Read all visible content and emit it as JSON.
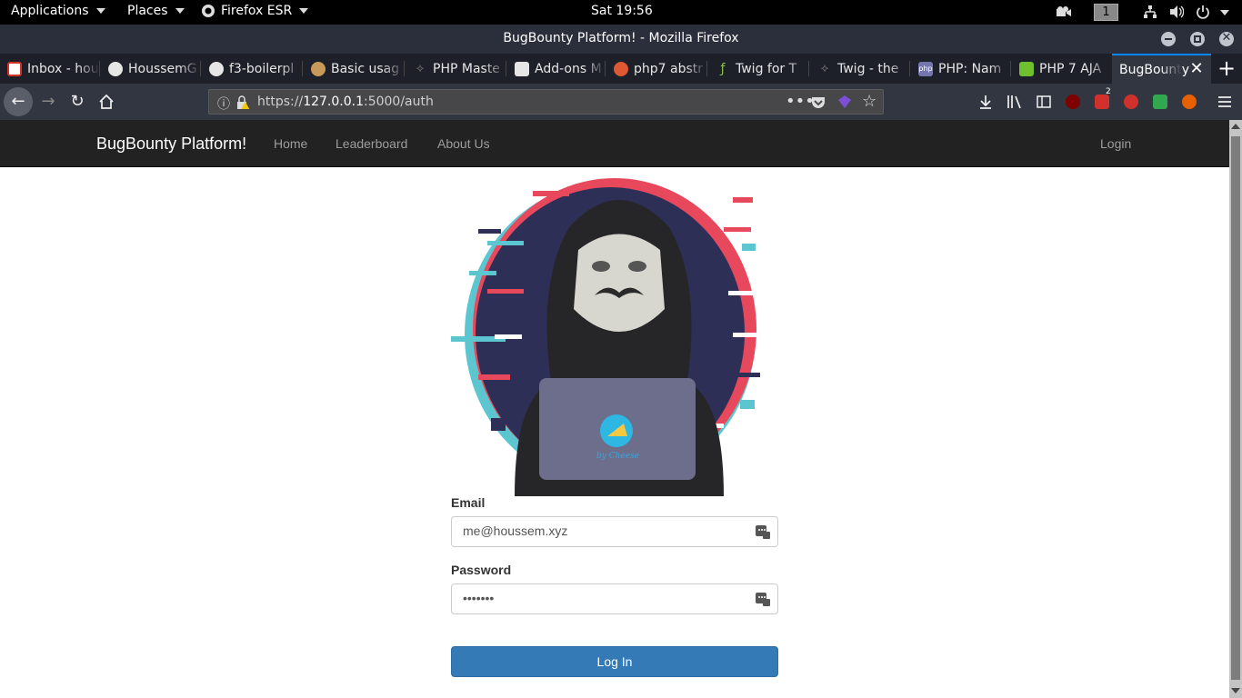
{
  "system": {
    "applications": "Applications",
    "places": "Places",
    "firefox_app": "Firefox ESR",
    "clock": "Sat 19:56",
    "workspace": "1"
  },
  "window": {
    "title": "BugBounty Platform! - Mozilla Firefox"
  },
  "tabs": [
    {
      "label": "Inbox - hou",
      "icon": "gmail-icon",
      "color": "#d93025"
    },
    {
      "label": "HoussemG",
      "icon": "github-icon",
      "color": "#e6e6e6"
    },
    {
      "label": "f3-boilerpl",
      "icon": "github-icon",
      "color": "#e6e6e6"
    },
    {
      "label": "Basic usag",
      "icon": "dog-icon",
      "color": "#c89a5a"
    },
    {
      "label": "PHP Maste",
      "icon": "php-master-icon",
      "color": "#777"
    },
    {
      "label": "Add-ons M",
      "icon": "puzzle-icon",
      "color": "#e6e6e6"
    },
    {
      "label": "php7 abstr",
      "icon": "duckduckgo-icon",
      "color": "#de5833"
    },
    {
      "label": "Twig for T",
      "icon": "twig-icon",
      "color": "#8bc34a"
    },
    {
      "label": "Twig - the",
      "icon": "twig-icon",
      "color": "#777"
    },
    {
      "label": "PHP: Nam",
      "icon": "php-icon",
      "color": "#7377ad"
    },
    {
      "label": "PHP 7 AJA",
      "icon": "chart-icon",
      "color": "#6fbf2f"
    },
    {
      "label": "BugBounty",
      "icon": "none",
      "color": "#323640"
    }
  ],
  "toolbar": {
    "url_prefix": "https://",
    "url_host": "127.0.0.1",
    "url_rest": ":5000/auth"
  },
  "site": {
    "brand": "BugBounty Platform!",
    "nav": [
      "Home",
      "Leaderboard",
      "About Us"
    ],
    "login_link": "Login"
  },
  "form": {
    "email_label": "Email",
    "email_value": "me@houssem.xyz",
    "password_label": "Password",
    "password_value": "•••••••",
    "submit_label": "Log In"
  },
  "logo": {
    "caption": "by Cheese"
  },
  "colors": {
    "navbar": "#222222",
    "primary_button": "#337ab7",
    "firefox_dark": "#323640"
  }
}
